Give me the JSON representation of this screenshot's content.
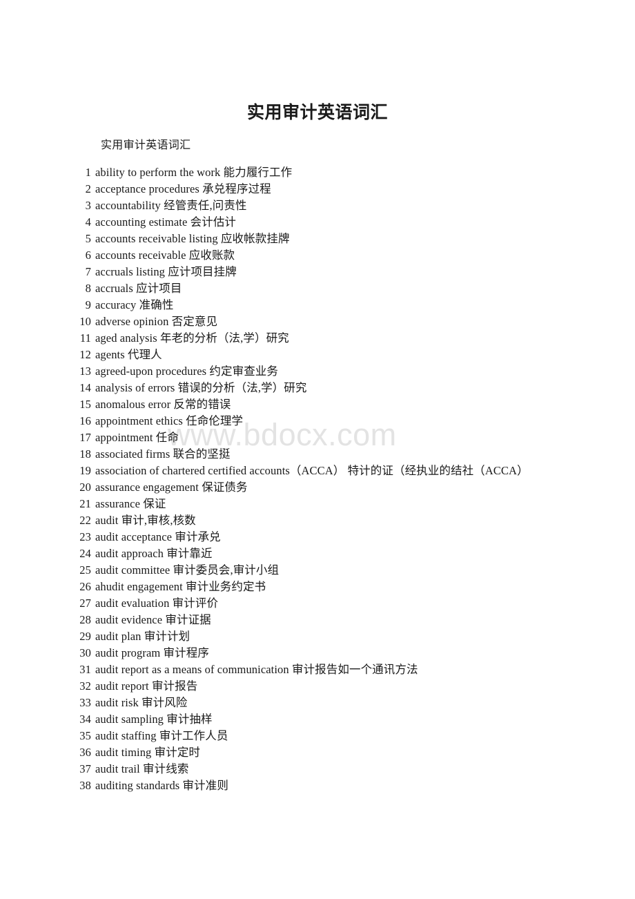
{
  "document": {
    "title": "实用审计英语词汇",
    "intro": "实用审计英语词汇",
    "watermark": "www.bdocx.com"
  },
  "glossary": {
    "entries": [
      {
        "num": "1",
        "text": "ability to perform the work   能力履行工作"
      },
      {
        "num": "2",
        "text": "acceptance procedures   承兑程序过程"
      },
      {
        "num": "3",
        "text": "accountability   经管责任,问责性"
      },
      {
        "num": "4",
        "text": "accounting estimate   会计估计"
      },
      {
        "num": "5",
        "text": "accounts receivable listing   应收帐款挂牌"
      },
      {
        "num": "6",
        "text": "accounts receivable   应收账款"
      },
      {
        "num": "7",
        "text": "accruals listing   应计项目挂牌"
      },
      {
        "num": "8",
        "text": "accruals   应计项目"
      },
      {
        "num": "9",
        "text": "accuracy   准确性"
      },
      {
        "num": "10",
        "text": "adverse opinion   否定意见"
      },
      {
        "num": "11",
        "text": "aged analysis   年老的分析（法,学）研究"
      },
      {
        "num": "12",
        "text": "agents   代理人"
      },
      {
        "num": "13",
        "text": "agreed-upon procedures   约定审查业务"
      },
      {
        "num": "14",
        "text": "analysis of errors   错误的分析（法,学）研究"
      },
      {
        "num": "15",
        "text": "anomalous error   反常的错误"
      },
      {
        "num": "16",
        "text": "appointment ethics   任命伦理学"
      },
      {
        "num": "17",
        "text": "appointment    任命"
      },
      {
        "num": "18",
        "text": "associated firms    联合的坚挺"
      },
      {
        "num": "19",
        "text": "association of chartered certified accounts（ACCA）   特计的证（经执业的结社（ACCA）",
        "wraps": true
      },
      {
        "num": "20",
        "text": "assurance engagement    保证债务"
      },
      {
        "num": "21",
        "text": "assurance   保证"
      },
      {
        "num": "22",
        "text": "audit   审计,审核,核数"
      },
      {
        "num": "23",
        "text": "audit acceptance    审计承兑"
      },
      {
        "num": "24",
        "text": "audit approach    审计靠近"
      },
      {
        "num": "25",
        "text": "audit committee   审计委员会,审计小组"
      },
      {
        "num": "26",
        "text": "ahudit engagement   审计业务约定书"
      },
      {
        "num": "27",
        "text": "audit evaluation    审计评价"
      },
      {
        "num": "28",
        "text": "audit evidence   审计证据"
      },
      {
        "num": "29",
        "text": "audit plan   审计计划"
      },
      {
        "num": "30",
        "text": "audit program   审计程序"
      },
      {
        "num": "31",
        "text": "audit report as a means of communication    审计报告如一个通讯方法"
      },
      {
        "num": "32",
        "text": "audit report    审计报告"
      },
      {
        "num": "33",
        "text": "audit risk   审计风险"
      },
      {
        "num": "34",
        "text": "audit sampling   审计抽样"
      },
      {
        "num": "35",
        "text": "audit staffing   审计工作人员"
      },
      {
        "num": "36",
        "text": "audit timing    审计定时"
      },
      {
        "num": "37",
        "text": "audit trail   审计线索"
      },
      {
        "num": "38",
        "text": "auditing standards   审计准则"
      }
    ]
  }
}
